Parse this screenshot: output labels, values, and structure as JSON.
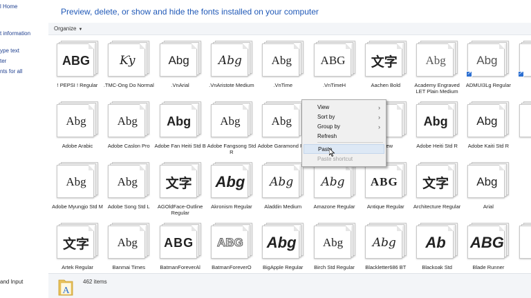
{
  "nav": {
    "links": [
      {
        "text": "l Home",
        "dark": false
      },
      {
        "text": "t information",
        "dark": false
      },
      {
        "text": "ype text",
        "dark": false
      },
      {
        "text": "ter",
        "dark": false
      },
      {
        "text": "nts for all",
        "dark": false
      },
      {
        "text": "and Input",
        "dark": true
      }
    ]
  },
  "header": {
    "title": "Preview, delete, or show and hide the fonts installed on your computer"
  },
  "toolbar": {
    "organize_label": "Organize"
  },
  "fonts": [
    {
      "name": "! PEPSI ! Regular",
      "preview": "ABG",
      "style": "g-bold"
    },
    {
      "name": ".TMC-Ong Do Normal",
      "preview": "Ƙy",
      "style": "g-script"
    },
    {
      "name": ".VnArial",
      "preview": "Abg",
      "style": ""
    },
    {
      "name": ".VnAristote Medium",
      "preview": "Abg",
      "style": "g-script"
    },
    {
      "name": ".VnTime",
      "preview": "Abg",
      "style": "g-serif"
    },
    {
      "name": ".VnTimeH",
      "preview": "ABG",
      "style": "g-serif"
    },
    {
      "name": "Aachen Bold",
      "preview": "文字",
      "style": "g-cjk"
    },
    {
      "name": "Academy Engraved LET Plain Medium",
      "preview": "Abg",
      "style": "g-serif g-light"
    },
    {
      "name": "ADMUI3Lg Regular",
      "preview": "Abg",
      "style": "g-light",
      "shortcut": true
    },
    {
      "name": "AD",
      "preview": "A",
      "style": "",
      "shortcut": true
    },
    {
      "name": "Adobe Arabic",
      "preview": "Abg",
      "style": "g-serif"
    },
    {
      "name": "Adobe Caslon Pro",
      "preview": "Abg",
      "style": "g-serif"
    },
    {
      "name": "Adobe Fan Heiti Std B",
      "preview": "Abg",
      "style": "g-bold"
    },
    {
      "name": "Adobe Fangsong Std R",
      "preview": "Abg",
      "style": "g-serif"
    },
    {
      "name": "Adobe Garamond Pro",
      "preview": "Abg",
      "style": "g-serif"
    },
    {
      "name": "",
      "preview": "",
      "style": ""
    },
    {
      "name": "ebrew",
      "preview": "",
      "style": ""
    },
    {
      "name": "Adobe Heiti Std R",
      "preview": "Abg",
      "style": "g-bold"
    },
    {
      "name": "Adobe Kaiti Std R",
      "preview": "Abg",
      "style": ""
    },
    {
      "name": "Ado",
      "preview": "A",
      "style": ""
    },
    {
      "name": "Adobe Myungjo Std M",
      "preview": "Abg",
      "style": "g-serif"
    },
    {
      "name": "Adobe Song Std L",
      "preview": "Abg",
      "style": "g-serif"
    },
    {
      "name": "AGOldFace-Outline Regular",
      "preview": "文字",
      "style": "g-cjk"
    },
    {
      "name": "Akronism Regular",
      "preview": "Abg",
      "style": "g-heavy"
    },
    {
      "name": "Aladdin Medium",
      "preview": "Abg",
      "style": "g-script"
    },
    {
      "name": "Amazone Regular",
      "preview": "Abg",
      "style": "g-script"
    },
    {
      "name": "Antique Regular",
      "preview": "ABG",
      "style": "g-serif g-wide"
    },
    {
      "name": "Architecture Regular",
      "preview": "文字",
      "style": "g-cjk"
    },
    {
      "name": "Arial",
      "preview": "Abg",
      "style": ""
    },
    {
      "name": "",
      "preview": "",
      "style": ""
    },
    {
      "name": "Artek Regular",
      "preview": "文字",
      "style": "g-cjk"
    },
    {
      "name": "Banmai Times",
      "preview": "Abg",
      "style": "g-serif"
    },
    {
      "name": "BatmanForeverAl",
      "preview": "ABG",
      "style": "g-bold g-wide"
    },
    {
      "name": "BatmanForeverO",
      "preview": "ABG",
      "style": "g-outline"
    },
    {
      "name": "BigApple Regular",
      "preview": "Abg",
      "style": "g-heavy"
    },
    {
      "name": "Birch Std Regular",
      "preview": "Abg",
      "style": "g-serif"
    },
    {
      "name": "Blackletter686 BT",
      "preview": "Abg",
      "style": "g-script"
    },
    {
      "name": "Blackoak Std",
      "preview": "Ab",
      "style": "g-heavy"
    },
    {
      "name": "Blade Runner",
      "preview": "ABG",
      "style": "g-heavy"
    },
    {
      "name": "Boo",
      "preview": "",
      "style": ""
    }
  ],
  "context_menu": {
    "items": [
      {
        "label": "View",
        "submenu": true,
        "state": "normal"
      },
      {
        "label": "Sort by",
        "submenu": true,
        "state": "normal"
      },
      {
        "label": "Group by",
        "submenu": true,
        "state": "normal"
      },
      {
        "label": "Refresh",
        "submenu": false,
        "state": "normal"
      },
      {
        "label": "Paste",
        "submenu": false,
        "state": "highlighted"
      },
      {
        "label": "Paste shortcut",
        "submenu": false,
        "state": "disabled"
      }
    ]
  },
  "status": {
    "item_count": "462 items"
  },
  "colors": {
    "accent": "#1f58b7",
    "highlight": "#dde8f5",
    "link": "#1e3f8f"
  }
}
